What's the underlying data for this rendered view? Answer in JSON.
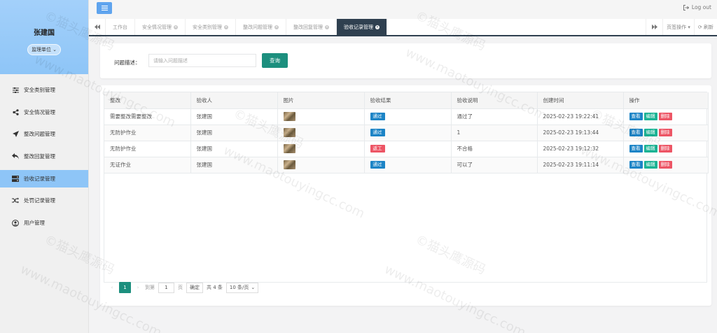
{
  "sidebar": {
    "user_name": "张建国",
    "role": "监理单位",
    "items": [
      {
        "label": "安全类别管理",
        "icon": "sliders-icon",
        "active": false
      },
      {
        "label": "安全情况管理",
        "icon": "share-icon",
        "active": false
      },
      {
        "label": "整改问题管理",
        "icon": "send-icon",
        "active": false
      },
      {
        "label": "整改回复管理",
        "icon": "reply-icon",
        "active": false
      },
      {
        "label": "验收记录管理",
        "icon": "server-icon",
        "active": true
      },
      {
        "label": "处罚记录管理",
        "icon": "shuffle-icon",
        "active": false
      },
      {
        "label": "用户管理",
        "icon": "user-circle-icon",
        "active": false
      }
    ]
  },
  "topbar": {
    "logout_label": "Log out"
  },
  "tabs": {
    "items": [
      {
        "label": "工作台",
        "closable": false,
        "active": false
      },
      {
        "label": "安全情况管理",
        "closable": true,
        "active": false
      },
      {
        "label": "安全类别管理",
        "closable": true,
        "active": false
      },
      {
        "label": "整改问题管理",
        "closable": true,
        "active": false
      },
      {
        "label": "整改回复管理",
        "closable": true,
        "active": false
      },
      {
        "label": "验收记录管理",
        "closable": true,
        "active": true
      }
    ],
    "page_ops_label": "页签操作",
    "refresh_label": "刷新"
  },
  "search": {
    "label": "问题描述：",
    "placeholder": "请输入问题描述",
    "button_label": "查询"
  },
  "table": {
    "columns": [
      "整改",
      "验收人",
      "图片",
      "验收结果",
      "验收说明",
      "创建时间",
      "操作"
    ],
    "rows": [
      {
        "rectify": "需要整改需要整改",
        "inspector": "张建国",
        "result": "通过",
        "result_color": "#1c84c6",
        "note": "通过了",
        "created": "2025-02-23 19:22:41"
      },
      {
        "rectify": "无防护作业",
        "inspector": "张建国",
        "result": "通过",
        "result_color": "#1c84c6",
        "note": "1",
        "created": "2025-02-23 19:13:44"
      },
      {
        "rectify": "无防护作业",
        "inspector": "张建国",
        "result": "返工",
        "result_color": "#ed5565",
        "note": "不合格",
        "created": "2025-02-23 19:12:32"
      },
      {
        "rectify": "无证作业",
        "inspector": "张建国",
        "result": "通过",
        "result_color": "#1c84c6",
        "note": "可以了",
        "created": "2025-02-23 19:11:14"
      }
    ],
    "actions": {
      "view": "查看",
      "edit": "编辑",
      "delete": "删除"
    }
  },
  "pagination": {
    "current_page": "1",
    "goto_label": "到第",
    "goto_value": "1",
    "page_unit": "页",
    "confirm_label": "确定",
    "total_label": "共 4 条",
    "page_size": "10 条/页"
  },
  "watermark": {
    "brand": "©猫头鹰源码",
    "url": "www.maotouyingcc.com"
  }
}
